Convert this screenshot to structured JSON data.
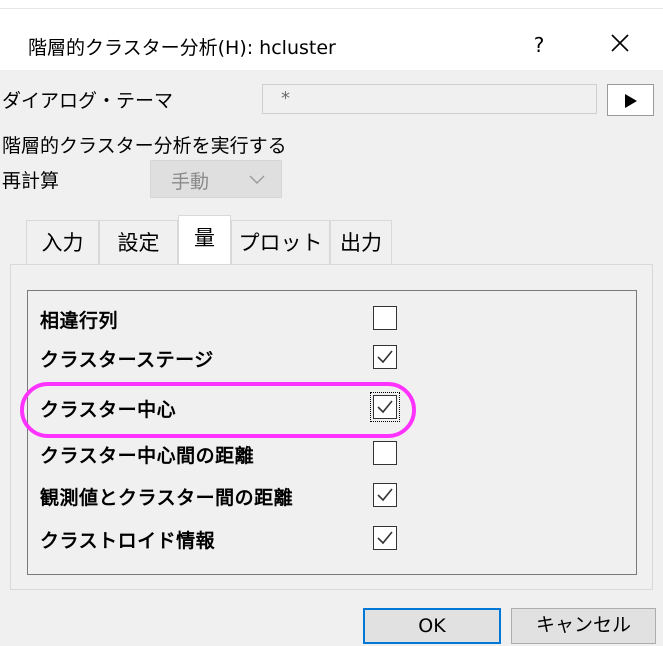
{
  "window": {
    "title": "階層的クラスター分析(H): hcluster",
    "help_label": "?",
    "close_icon": "close-icon"
  },
  "dialog_theme": {
    "label": "ダイアログ・テーマ",
    "value": "*",
    "arrow_icon": "play-arrow-icon"
  },
  "description": "階層的クラスター分析を実行する",
  "recalculate": {
    "label": "再計算",
    "value": "手動"
  },
  "tabs": [
    {
      "label": "入力",
      "active": false
    },
    {
      "label": "設定",
      "active": false
    },
    {
      "label": "量",
      "active": true
    },
    {
      "label": "プロット",
      "active": false
    },
    {
      "label": "出力",
      "active": false
    }
  ],
  "options": [
    {
      "label": "相違行列",
      "checked": false
    },
    {
      "label": "クラスターステージ",
      "checked": true
    },
    {
      "label": "クラスター中心",
      "checked": true,
      "highlighted": true
    },
    {
      "label": "クラスター中心間の距離",
      "checked": false
    },
    {
      "label": "観測値とクラスター間の距離",
      "checked": true
    },
    {
      "label": "クラストロイド情報",
      "checked": true
    }
  ],
  "buttons": {
    "ok": "OK",
    "cancel": "キャンセル"
  },
  "colors": {
    "highlight": "#ff33ff",
    "default_button_border": "#0078d7"
  }
}
